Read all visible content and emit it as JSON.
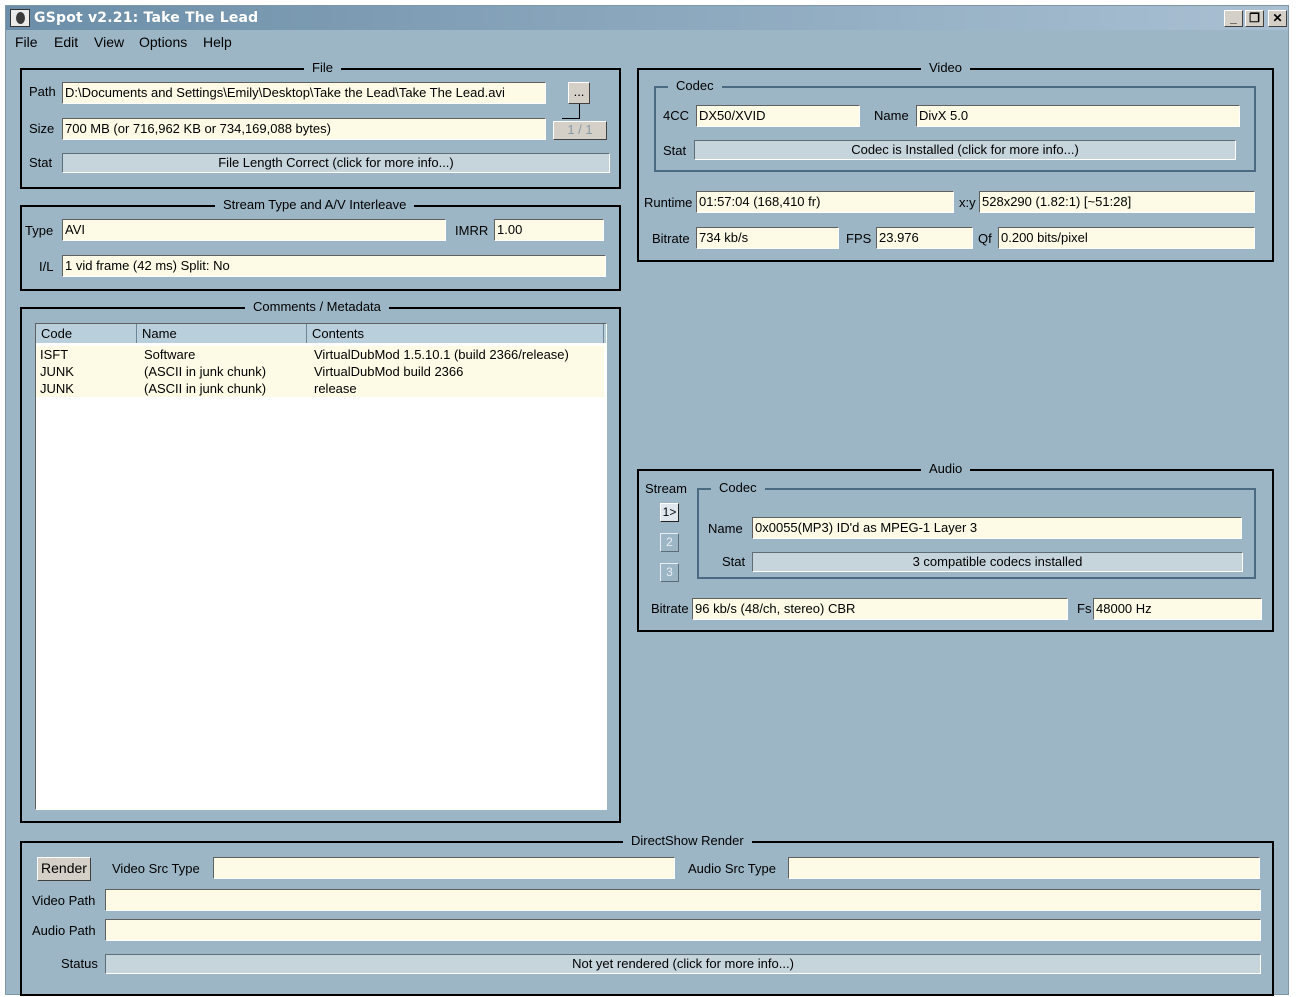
{
  "window": {
    "title": "GSpot v2.21: Take The Lead"
  },
  "menu": [
    "File",
    "Edit",
    "View",
    "Options",
    "Help"
  ],
  "file": {
    "legend": "File",
    "path_label": "Path",
    "path_value": "D:\\Documents and Settings\\Emily\\Desktop\\Take the Lead\\Take The Lead.avi",
    "browse_label": "...",
    "size_label": "Size",
    "size_value": "700 MB (or 716,962 KB or 734,169,088 bytes)",
    "part_label": "1 / 1",
    "stat_label": "Stat",
    "stat_value": "File Length Correct (click for more info...)"
  },
  "stream": {
    "legend": "Stream Type and A/V Interleave",
    "type_label": "Type",
    "type_value": "AVI",
    "imrr_label": "IMRR",
    "imrr_value": "1.00",
    "il_label": "I/L",
    "il_value": "1 vid frame (42 ms)  Split: No"
  },
  "comments": {
    "legend": "Comments / Metadata",
    "columns": [
      "Code",
      "Name",
      "Contents"
    ],
    "rows": [
      [
        "ISFT",
        "Software",
        "VirtualDubMod 1.5.10.1 (build 2366/release)"
      ],
      [
        "JUNK",
        "(ASCII in junk chunk)",
        "VirtualDubMod build 2366"
      ],
      [
        "JUNK",
        "(ASCII in junk chunk)",
        "release"
      ]
    ]
  },
  "video": {
    "legend": "Video",
    "codec_legend": "Codec",
    "fourcc_label": "4CC",
    "fourcc_value": "DX50/XVID",
    "name_label": "Name",
    "name_value": "DivX 5.0",
    "stat_label": "Stat",
    "stat_value": "Codec is Installed (click for more info...)",
    "runtime_label": "Runtime",
    "runtime_value": "01:57:04 (168,410 fr)",
    "xy_label": "x:y",
    "xy_value": "528x290 (1.82:1) [~51:28]",
    "bitrate_label": "Bitrate",
    "bitrate_value": "734 kb/s",
    "fps_label": "FPS",
    "fps_value": "23.976",
    "qf_label": "Qf",
    "qf_value": "0.200 bits/pixel"
  },
  "audio": {
    "legend": "Audio",
    "stream_label": "Stream",
    "stream_buttons": [
      "1>",
      "2",
      "3"
    ],
    "codec_legend": "Codec",
    "name_label": "Name",
    "name_value": "0x0055(MP3) ID'd as MPEG-1 Layer 3",
    "stat_label": "Stat",
    "stat_value": "3 compatible codecs installed",
    "bitrate_label": "Bitrate",
    "bitrate_value": "96 kb/s (48/ch, stereo) CBR",
    "fs_label": "Fs",
    "fs_value": "48000 Hz"
  },
  "directshow": {
    "legend": "DirectShow Render",
    "render_label": "Render",
    "video_src_label": "Video Src Type",
    "video_src_value": "",
    "audio_src_label": "Audio Src Type",
    "audio_src_value": "",
    "video_path_label": "Video Path",
    "video_path_value": "",
    "audio_path_label": "Audio Path",
    "audio_path_value": "",
    "status_label": "Status",
    "status_value": "Not yet rendered (click for more info...)"
  }
}
